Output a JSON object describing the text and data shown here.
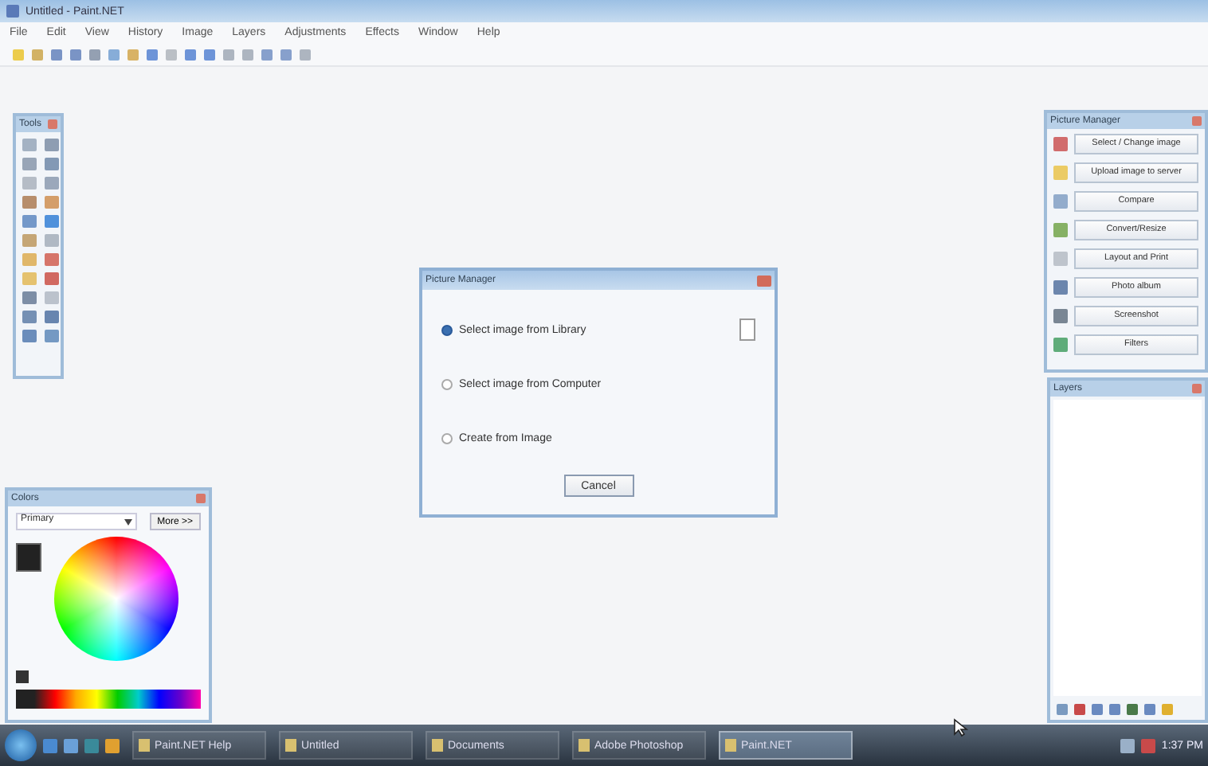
{
  "window": {
    "title": "Untitled - Paint.NET"
  },
  "menu": [
    "File",
    "Edit",
    "View",
    "History",
    "Image",
    "Layers",
    "Adjustments",
    "Effects",
    "Window",
    "Help"
  ],
  "tools_panel": {
    "title": "Tools"
  },
  "colors_panel": {
    "title": "Colors",
    "mode": "Primary",
    "more_button": "More >>"
  },
  "dialog": {
    "title": "Picture Manager",
    "options": [
      {
        "label": "Select image from Library",
        "selected": true
      },
      {
        "label": "Select image from Computer",
        "selected": false
      },
      {
        "label": "Create from Image",
        "selected": false
      }
    ],
    "cancel_button": "Cancel"
  },
  "picture_panel": {
    "title": "Picture Manager",
    "buttons": [
      "Select / Change image",
      "Upload image to server",
      "Compare",
      "Convert/Resize",
      "Layout and Print",
      "Photo album",
      "Screenshot",
      "Filters"
    ]
  },
  "layers_panel": {
    "title": "Layers"
  },
  "taskbar": {
    "tasks": [
      {
        "label": "Paint.NET Help",
        "selected": false
      },
      {
        "label": "Untitled",
        "selected": false
      },
      {
        "label": "Documents",
        "selected": false
      },
      {
        "label": "Adobe Photoshop",
        "selected": false
      },
      {
        "label": "Paint.NET",
        "selected": true
      }
    ],
    "clock": "1:37 PM"
  }
}
